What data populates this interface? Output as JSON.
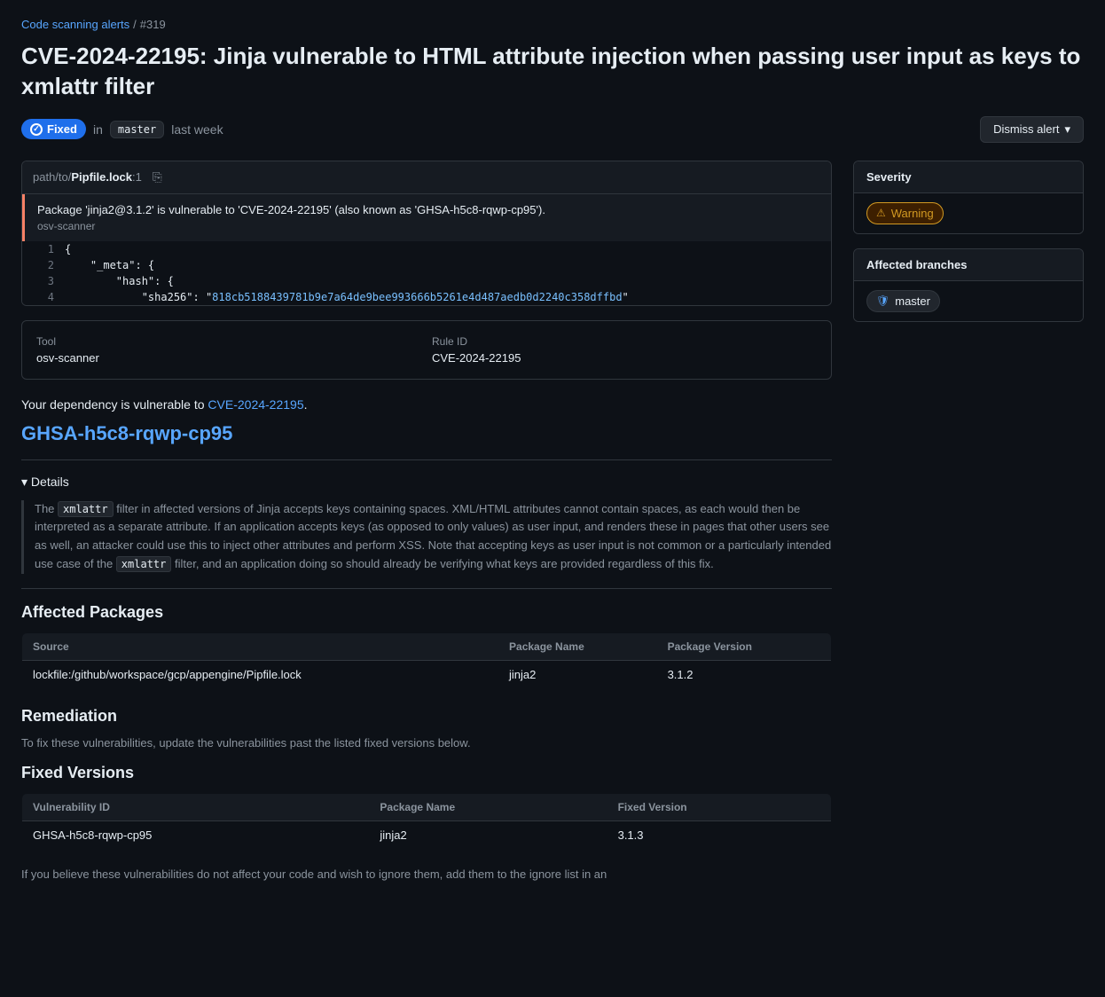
{
  "breadcrumb": {
    "link_text": "Code scanning alerts",
    "separator": "/",
    "issue_number": "#319"
  },
  "page": {
    "title": "CVE-2024-22195: Jinja vulnerable to HTML attribute injection when passing user input as keys to xmlattr filter"
  },
  "status": {
    "badge_label": "Fixed",
    "in_label": "in",
    "branch": "master",
    "time": "last week"
  },
  "dismiss_button": "Dismiss alert",
  "file": {
    "path": "path/to/",
    "filename": "Pipfile.lock",
    "line": ":1"
  },
  "alert": {
    "message": "Package 'jinja2@3.1.2' is vulnerable to 'CVE-2024-22195' (also known as 'GHSA-h5c8-rqwp-cp95').",
    "tool": "osv-scanner"
  },
  "code_lines": [
    {
      "num": "1",
      "code": "{"
    },
    {
      "num": "2",
      "code": "  \"_meta\": {"
    },
    {
      "num": "3",
      "code": "    \"hash\": {"
    },
    {
      "num": "4",
      "code": "      \"sha256\": \"818cb5188439781b9e7a64de9bee993666b5261e4d487aedb0d2240c358dffbd\""
    }
  ],
  "tool": {
    "label": "Tool",
    "value": "osv-scanner"
  },
  "rule_id": {
    "label": "Rule ID",
    "value": "CVE-2024-22195"
  },
  "dependency_text": "Your dependency is vulnerable to",
  "cve_link": "CVE-2024-22195",
  "ghsa_id": "GHSA-h5c8-rqwp-cp95",
  "details": {
    "summary": "▾ Details",
    "body_1": "The",
    "code_1": "xmlattr",
    "body_2": "filter in affected versions of Jinja accepts keys containing spaces. XML/HTML attributes cannot contain spaces, as each would then be interpreted as a separate attribute. If an application accepts keys (as opposed to only values) as user input, and renders these in pages that other users see as well, an attacker could use this to inject other attributes and perform XSS. Note that accepting keys as user input is not common or a particularly intended use case of the",
    "code_2": "xmlattr",
    "body_3": "filter, and an application doing so should already be verifying what keys are provided regardless of this fix."
  },
  "affected_packages": {
    "title": "Affected Packages",
    "columns": [
      "Source",
      "Package Name",
      "Package Version"
    ],
    "rows": [
      {
        "source": "lockfile:/github/workspace/gcp/appengine/Pipfile.lock",
        "package_name": "jinja2",
        "package_version": "3.1.2"
      }
    ]
  },
  "remediation": {
    "title": "Remediation",
    "text": "To fix these vulnerabilities, update the vulnerabilities past the listed fixed versions below."
  },
  "fixed_versions": {
    "title": "Fixed Versions",
    "columns": [
      "Vulnerability ID",
      "Package Name",
      "Fixed Version"
    ],
    "rows": [
      {
        "vuln_id": "GHSA-h5c8-rqwp-cp95",
        "package_name": "jinja2",
        "fixed_version": "3.1.3"
      }
    ]
  },
  "note_text": "If you believe these vulnerabilities do not affect your code and wish to ignore them, add them to the ignore list in an",
  "sidebar": {
    "severity_label": "Severity",
    "severity_value": "Warning",
    "affected_branches_label": "Affected branches",
    "branch_name": "master"
  },
  "icons": {
    "check": "✓",
    "chevron_down": "▾",
    "copy": "⎘",
    "warning": "⚠",
    "shield": "🛡",
    "dropdown_arrow": "▾"
  }
}
